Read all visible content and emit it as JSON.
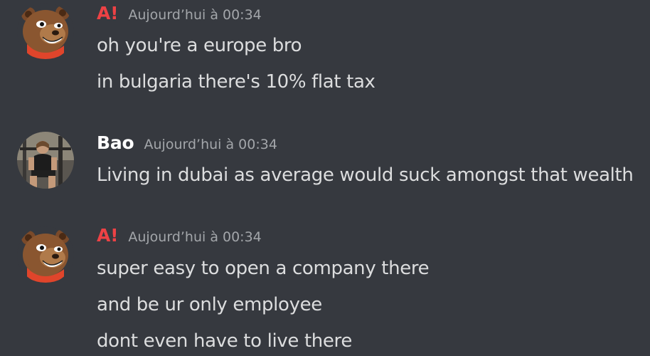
{
  "messages": [
    {
      "author": "A!",
      "author_color": "#ed4245",
      "timestamp": "Aujourd’hui à 00:34",
      "avatar": "bear-avatar",
      "lines": [
        "oh you're a europe bro",
        "in bulgaria there's 10% flat tax"
      ]
    },
    {
      "author": "Bao",
      "author_color": "#ffffff",
      "timestamp": "Aujourd’hui à 00:34",
      "avatar": "gym-photo-avatar",
      "lines": [
        "Living in dubai as average would suck amongst that wealth"
      ]
    },
    {
      "author": "A!",
      "author_color": "#ed4245",
      "timestamp": "Aujourd’hui à 00:34",
      "avatar": "bear-avatar",
      "lines": [
        "super easy to open a company there",
        "and be ur only employee",
        "dont even have to live there"
      ]
    }
  ]
}
